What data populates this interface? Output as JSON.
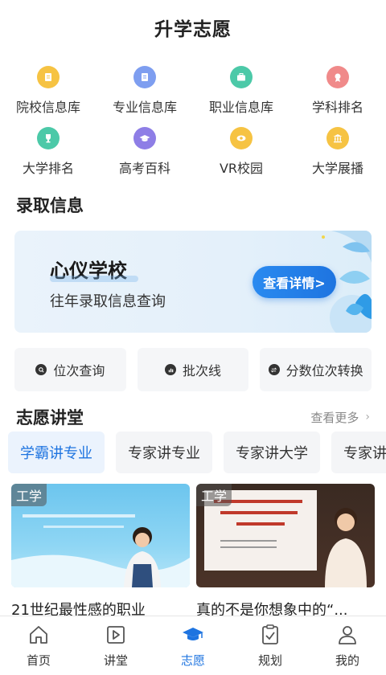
{
  "header": {
    "title": "升学志愿"
  },
  "grid": [
    {
      "label": "院校信息库",
      "icon": "school-doc-icon",
      "color": "#f6c343"
    },
    {
      "label": "专业信息库",
      "icon": "major-doc-icon",
      "color": "#7e9ef0"
    },
    {
      "label": "职业信息库",
      "icon": "briefcase-icon",
      "color": "#4cc9a8"
    },
    {
      "label": "学科排名",
      "icon": "medal-icon",
      "color": "#f08a8a"
    },
    {
      "label": "大学排名",
      "icon": "trophy-icon",
      "color": "#4cc9a8"
    },
    {
      "label": "高考百科",
      "icon": "graduation-cap-icon",
      "color": "#8e7ee6"
    },
    {
      "label": "VR校园",
      "icon": "vr-eye-icon",
      "color": "#f6c343"
    },
    {
      "label": "大学展播",
      "icon": "university-building-icon",
      "color": "#f6c343"
    }
  ],
  "admission": {
    "section_title": "录取信息",
    "banner_title": "心仪学校",
    "banner_sub": "往年录取信息查询",
    "detail_button": "查看详情>"
  },
  "quick": [
    {
      "label": "位次查询",
      "icon": "search-icon"
    },
    {
      "label": "批次线",
      "icon": "bar-chart-icon"
    },
    {
      "label": "分数位次转换",
      "icon": "swap-icon"
    }
  ],
  "lecture": {
    "section_title": "志愿讲堂",
    "more": "查看更多",
    "tabs": [
      "学霸讲专业",
      "专家讲专业",
      "专家讲大学",
      "专家讲"
    ],
    "cards": [
      {
        "tag": "工学",
        "title": "21世纪最性感的职业"
      },
      {
        "tag": "工学",
        "title": "真的不是你想象中的“..."
      }
    ]
  },
  "tabbar": [
    {
      "label": "首页",
      "icon": "home-icon"
    },
    {
      "label": "讲堂",
      "icon": "video-play-icon"
    },
    {
      "label": "志愿",
      "icon": "graduation-cap-icon",
      "active": true
    },
    {
      "label": "规划",
      "icon": "clipboard-check-icon"
    },
    {
      "label": "我的",
      "icon": "user-icon"
    }
  ],
  "colors": {
    "accent": "#1e74e0"
  }
}
